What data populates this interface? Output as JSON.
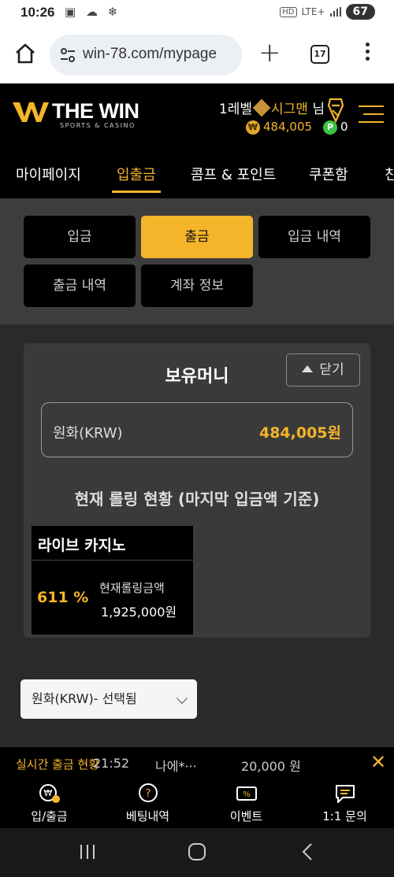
{
  "status_bar": {
    "time": "10:26",
    "left_icons": "▣ ☁ ❄",
    "hd": "HD",
    "network": "LTE+",
    "battery": "67"
  },
  "browser": {
    "url": "win-78.com/mypage",
    "tab_count": "17"
  },
  "header": {
    "logo_name": "THE WIN",
    "logo_sub": "SPORTS & CASINO",
    "level": "1레벨",
    "rank": "시그맨",
    "suffix": "님",
    "won_icon": "₩",
    "money": "484,005",
    "point_icon": "P",
    "points": "0"
  },
  "nav_tabs": [
    {
      "label": "마이페이지"
    },
    {
      "label": "입출금",
      "active": true
    },
    {
      "label": "콤프 & 포인트"
    },
    {
      "label": "쿠폰함"
    },
    {
      "label": "친"
    }
  ],
  "sub_tabs": [
    {
      "label": "입금"
    },
    {
      "label": "출금",
      "active": true
    },
    {
      "label": "입금 내역"
    },
    {
      "label": "출금 내역"
    },
    {
      "label": "계좌 정보"
    }
  ],
  "card": {
    "title": "보유머니",
    "close_label": "닫기",
    "currency_label": "원화(KRW)",
    "balance": "484,005원",
    "rolling_title": "현재 롤링 현황 (마지막 입금액 기준)",
    "rolling": {
      "category": "라이브 카지노",
      "percent": "611 %",
      "amount_label": "현재롤링금액",
      "amount": "1,925,000원"
    }
  },
  "currency_select": {
    "value": "원화(KRW)- 선택됨"
  },
  "ticker": {
    "label": "실시간 출금 현황",
    "time": "21:52",
    "user": "나에*···",
    "amount": "20,000 원"
  },
  "bottom_nav": [
    {
      "label": "입/출금",
      "icon": "wallet-icon"
    },
    {
      "label": "베팅내역",
      "icon": "question-icon"
    },
    {
      "label": "이벤트",
      "icon": "ticket-icon"
    },
    {
      "label": "1:1 문의",
      "icon": "chat-icon"
    }
  ],
  "colors": {
    "accent": "#f5b52a",
    "background": "#2a2a2a",
    "header": "#000000",
    "points_green": "#3cc443"
  }
}
